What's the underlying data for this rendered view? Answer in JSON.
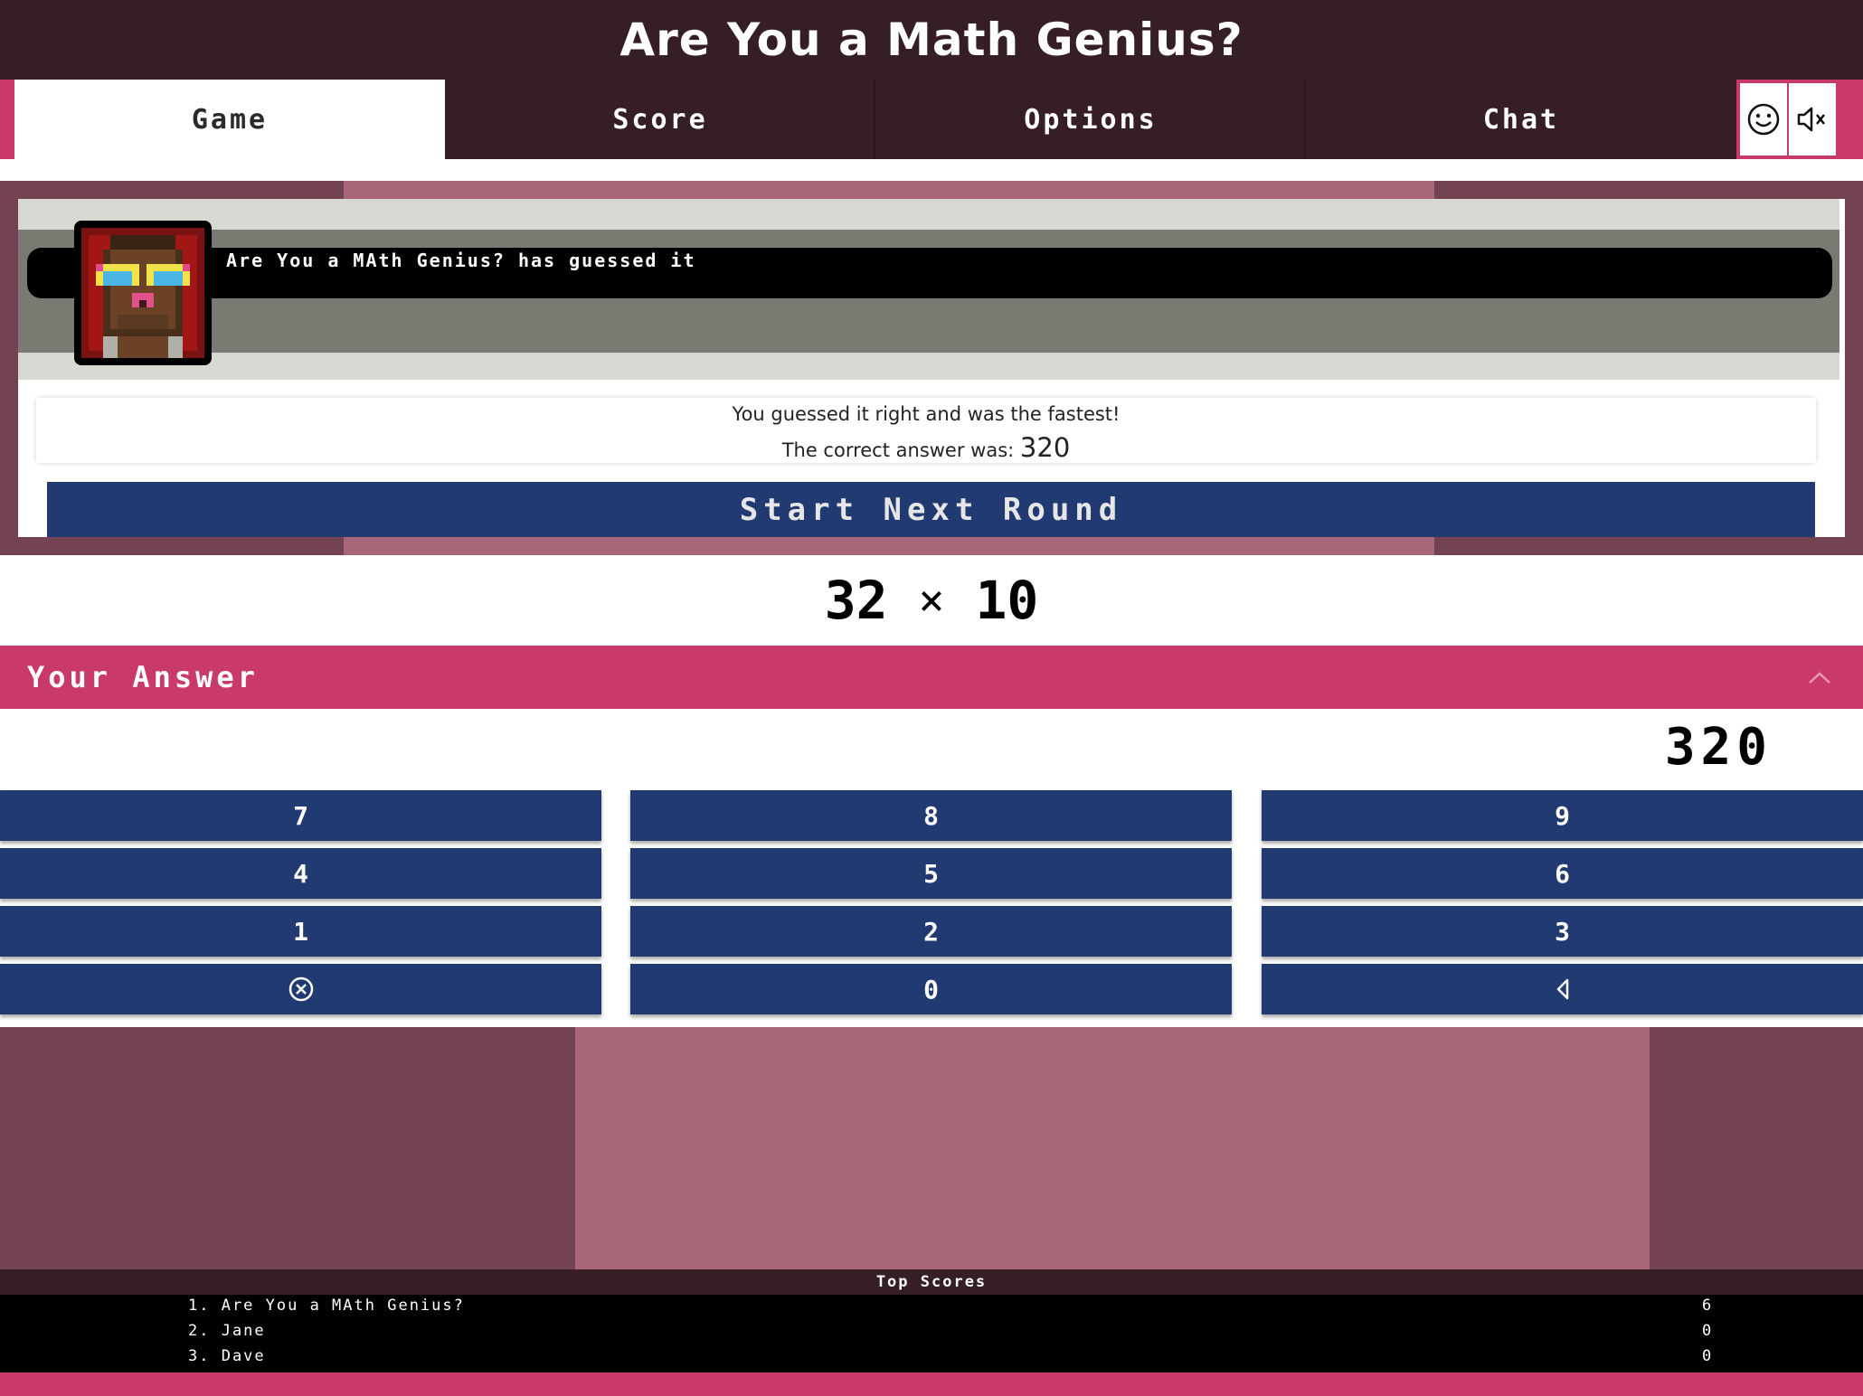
{
  "header": {
    "title": "Are You a Math Genius?"
  },
  "nav": {
    "tabs": [
      {
        "label": "Game",
        "active": true
      },
      {
        "label": "Score",
        "active": false
      },
      {
        "label": "Options",
        "active": false
      },
      {
        "label": "Chat",
        "active": false
      }
    ],
    "icons": [
      "smiley-icon",
      "mute-icon"
    ]
  },
  "result": {
    "notice": "Are You a MAth Genius? has guessed it",
    "line1": "You guessed it right and was the fastest!",
    "line2_prefix": "The correct answer was:",
    "correct_answer": "320",
    "next_button_label": "Start Next Round"
  },
  "question": {
    "operand_a": "32",
    "operator": "×",
    "operand_b": "10"
  },
  "answer": {
    "label": "Your Answer",
    "value": "320"
  },
  "keypad": {
    "keys": [
      "7",
      "8",
      "9",
      "4",
      "5",
      "6",
      "1",
      "2",
      "3",
      "⊗",
      "0",
      "◁"
    ],
    "clear_icon": "clear-circle-x-icon",
    "backspace_icon": "backspace-triangle-icon"
  },
  "top_scores": {
    "title": "Top Scores",
    "rows": [
      {
        "name": "1. Are You a MAth Genius?",
        "score": "6"
      },
      {
        "name": "2. Jane",
        "score": "0"
      },
      {
        "name": "3. Dave",
        "score": "0"
      }
    ]
  },
  "colors": {
    "header_bg": "#361e25",
    "accent_pink": "#c93a68",
    "button_blue": "#213a72",
    "scene_dark": "#734353",
    "scene_light": "#a86778"
  }
}
